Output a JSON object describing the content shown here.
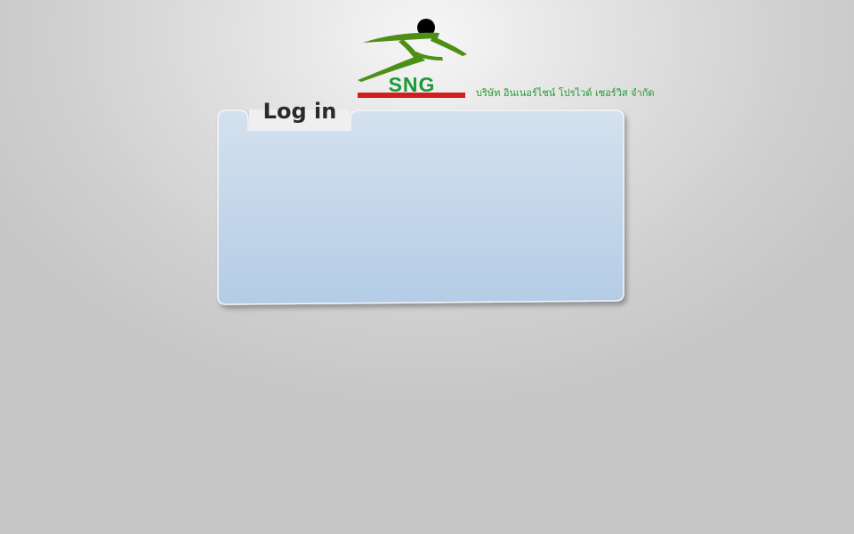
{
  "logo": {
    "icon": "running-figure-icon",
    "letters": "SNG",
    "colors": {
      "green": "#4d8f16",
      "red": "#d21e1e",
      "text_green": "#1b9a3a",
      "head": "#000000"
    }
  },
  "company": {
    "name": "บริษัท อินเนอร์ไชน์ โปรไวด์ เซอร์วิส จำกัด"
  },
  "login_panel": {
    "title": "Log in",
    "colors": {
      "fill_top": "#d4e1ee",
      "fill_bottom": "#b4cce6",
      "tab": "#efefef",
      "border": "#f4f6f9"
    }
  }
}
